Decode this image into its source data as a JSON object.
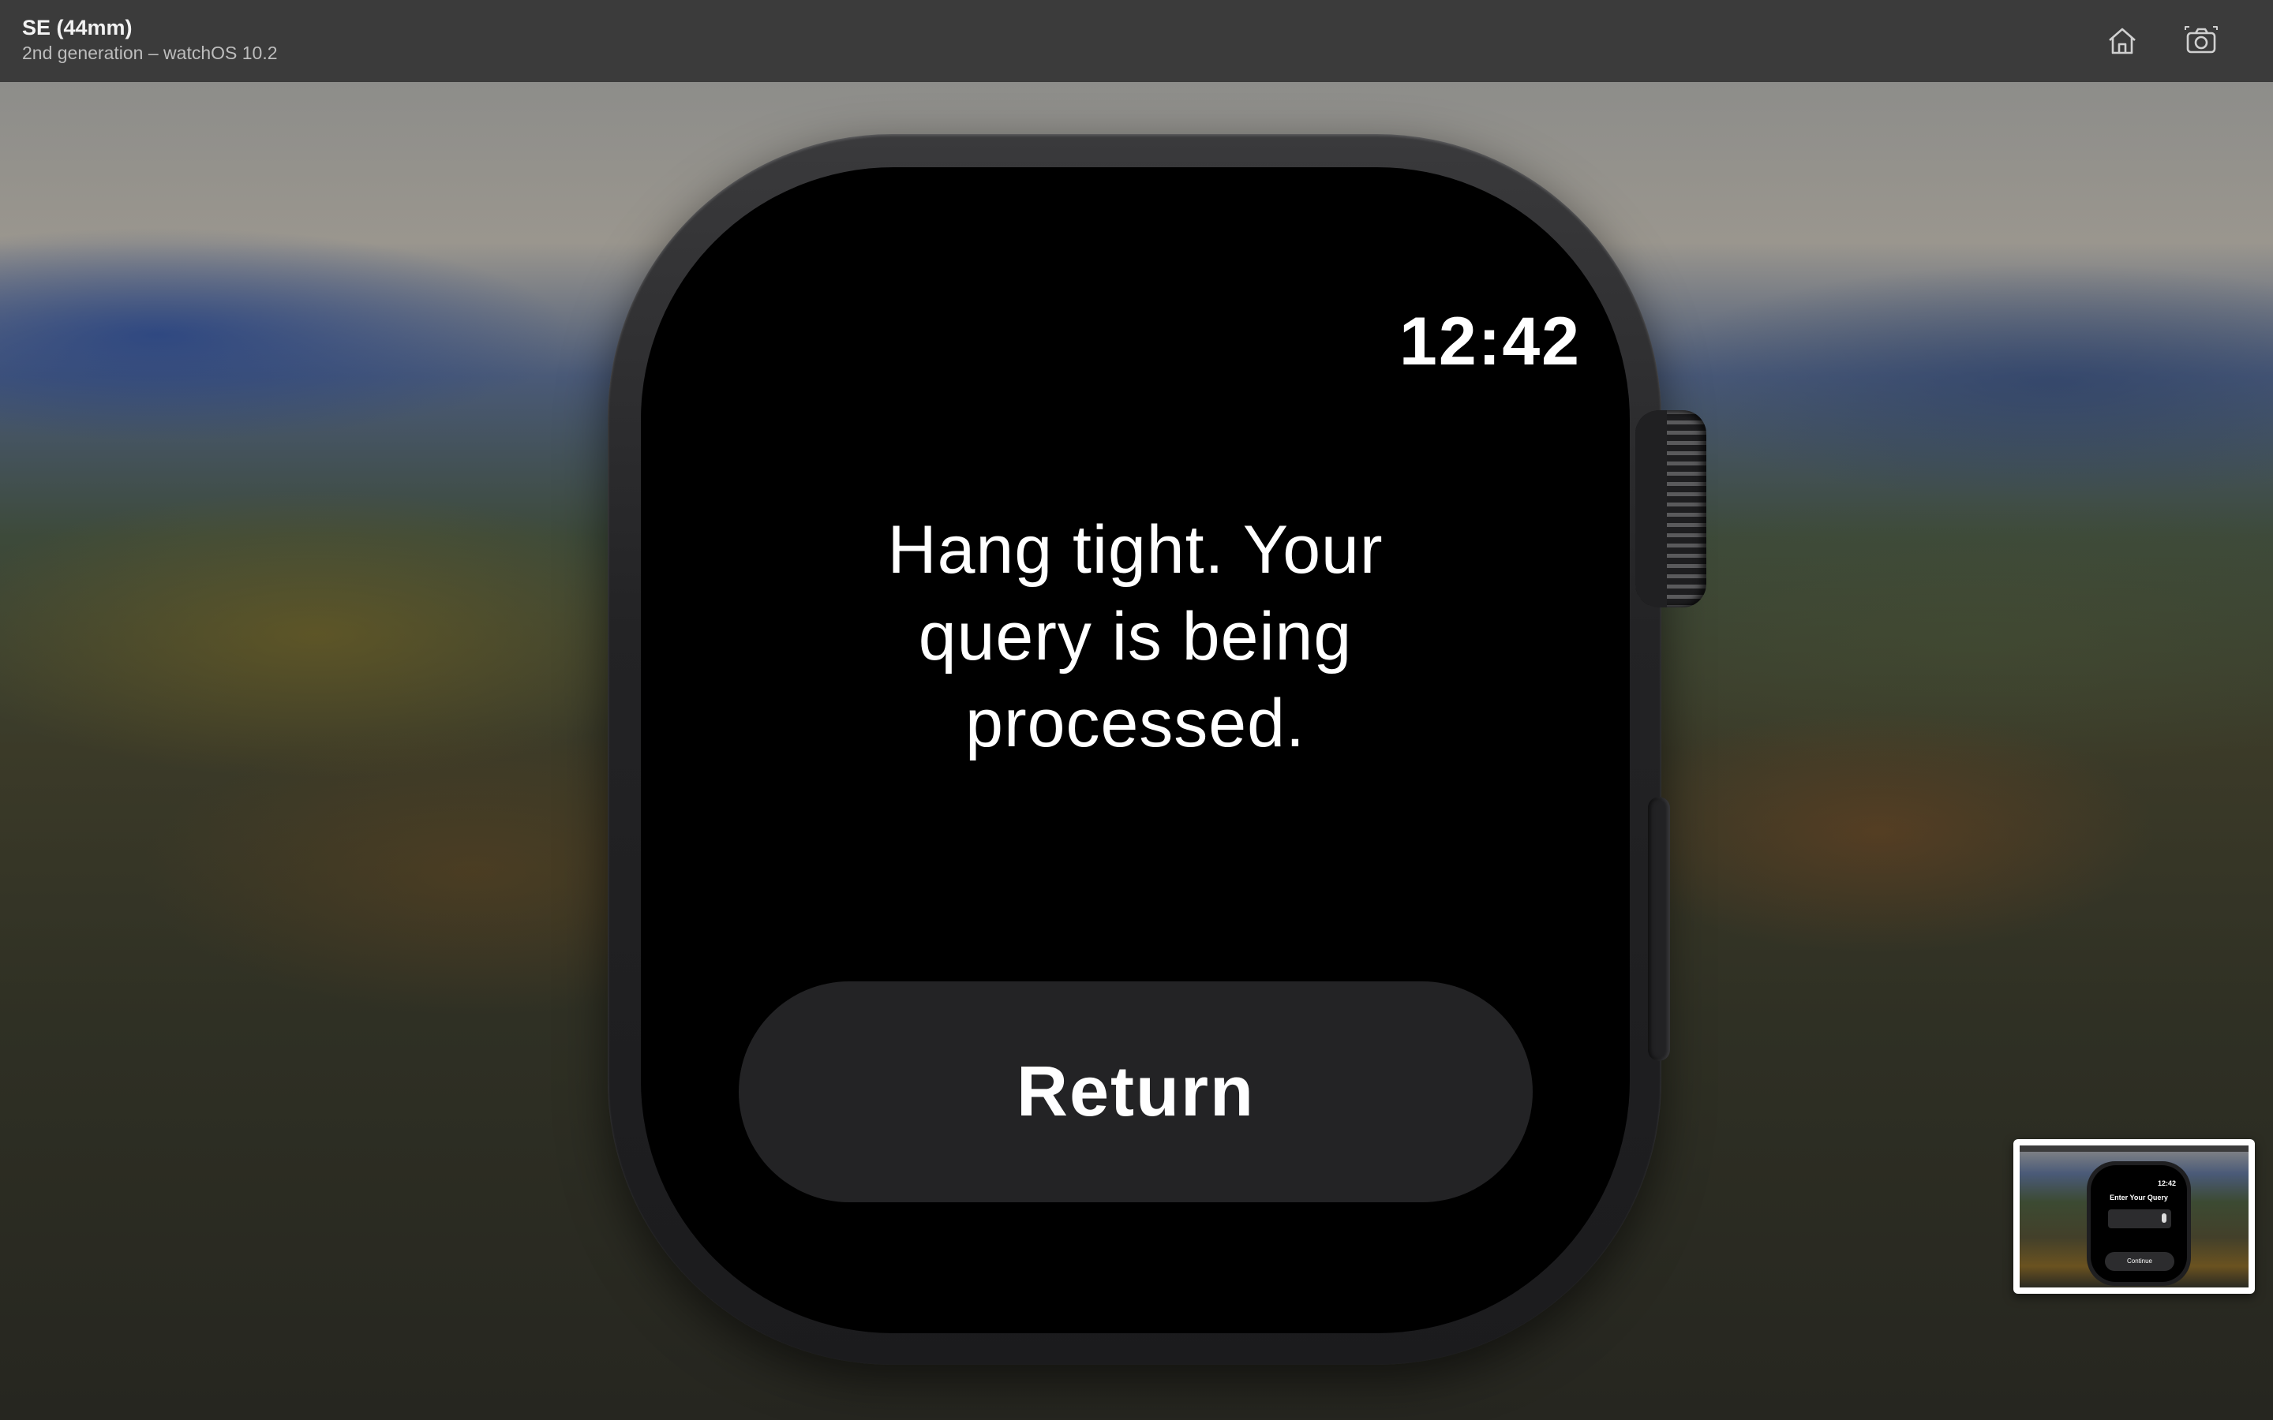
{
  "titlebar": {
    "device_name": "SE (44mm)",
    "device_subtitle": "2nd generation – watchOS 10.2",
    "home_icon": "home-icon",
    "screenshot_icon": "camera-icon"
  },
  "watch": {
    "time": "12:42",
    "message": "Hang tight. Your query is being processed.",
    "return_label": "Return"
  },
  "thumbnail": {
    "time": "12:42",
    "title": "Enter Your Query",
    "continue_label": "Continue",
    "mic_icon": "microphone-icon"
  },
  "colors": {
    "titlebar_bg": "#3b3b3b",
    "screen_bg": "#000000",
    "button_bg": "#232325",
    "text": "#ffffff"
  }
}
